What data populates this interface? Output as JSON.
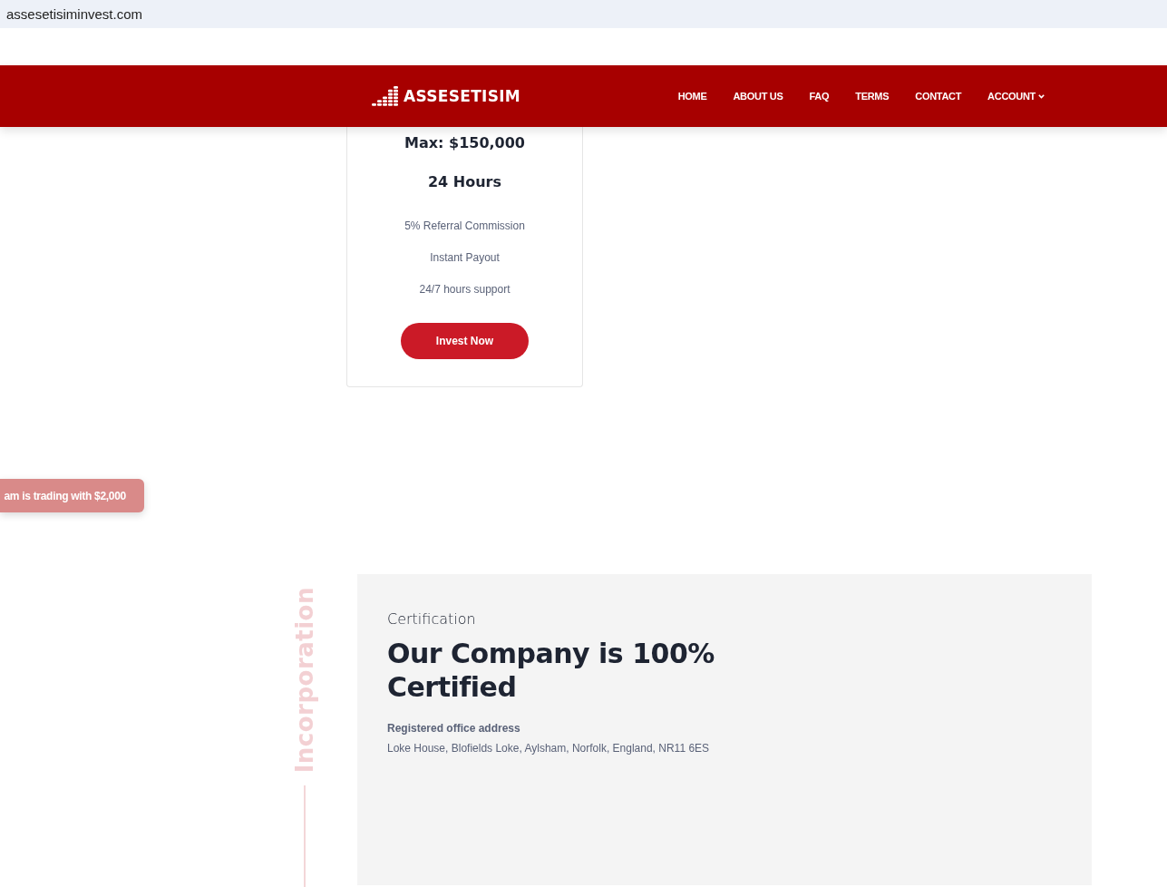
{
  "browser": {
    "address": "assesetisiminvest.com"
  },
  "nav": {
    "brand": "ASSESETISIM",
    "items": [
      {
        "label": "HOME",
        "dropdown": false
      },
      {
        "label": "ABOUT US",
        "dropdown": false
      },
      {
        "label": "FAQ",
        "dropdown": false
      },
      {
        "label": "TERMS",
        "dropdown": false
      },
      {
        "label": "CONTACT",
        "dropdown": false
      },
      {
        "label": "ACCOUNT",
        "dropdown": true
      }
    ]
  },
  "plan": {
    "max": "Max: $150,000",
    "duration": "24 Hours",
    "features": [
      "5% Referral Commission",
      "Instant Payout",
      "24/7 hours support"
    ],
    "button": "Invest Now"
  },
  "toast": "am is trading with $2,000",
  "certification": {
    "side_label": "Incorporation",
    "eyebrow": "Certification",
    "title_lines": [
      "Our Company is 100%",
      "Certified"
    ],
    "address_label": "Registered office address",
    "address": "Loke House, Blofields Loke, Aylsham, Norfolk, England, NR11 6ES"
  }
}
